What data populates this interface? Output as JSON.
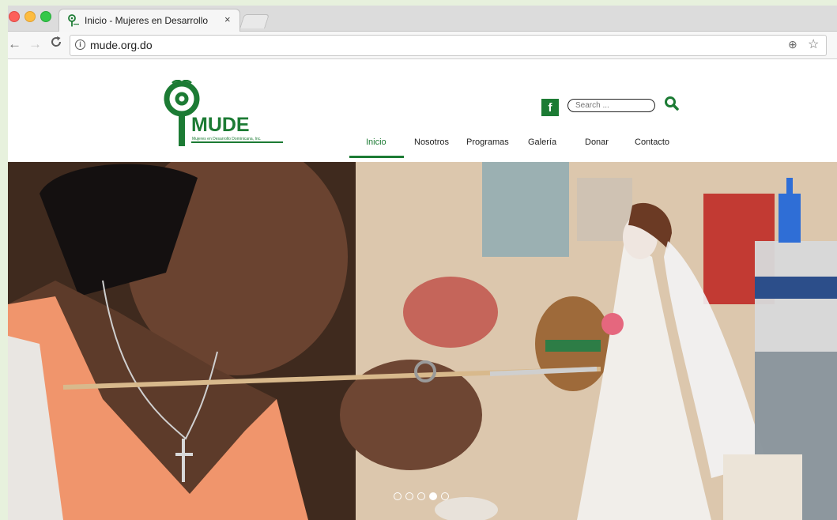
{
  "browser": {
    "tab_title": "Inicio - Mujeres en Desarrollo",
    "tab_close": "×",
    "url": "mude.org.do",
    "back": "←",
    "forward": "→",
    "reload": "C",
    "zoom": "⊕",
    "star": "☆",
    "info": "i"
  },
  "site": {
    "logo_text": "MUDE",
    "logo_tagline": "Mujeres en Desarrollo Dominicana, Inc.",
    "facebook_label": "f",
    "search_placeholder": "Search ...",
    "menu": [
      {
        "label": "Inicio",
        "active": true
      },
      {
        "label": "Nosotros"
      },
      {
        "label": "Programas"
      },
      {
        "label": "Galería"
      },
      {
        "label": "Donar"
      },
      {
        "label": "Contacto"
      }
    ],
    "slider": {
      "count": 5,
      "active_index": 3
    }
  },
  "colors": {
    "brand_green": "#1c7b34",
    "page_background": "#e7f1dd"
  }
}
